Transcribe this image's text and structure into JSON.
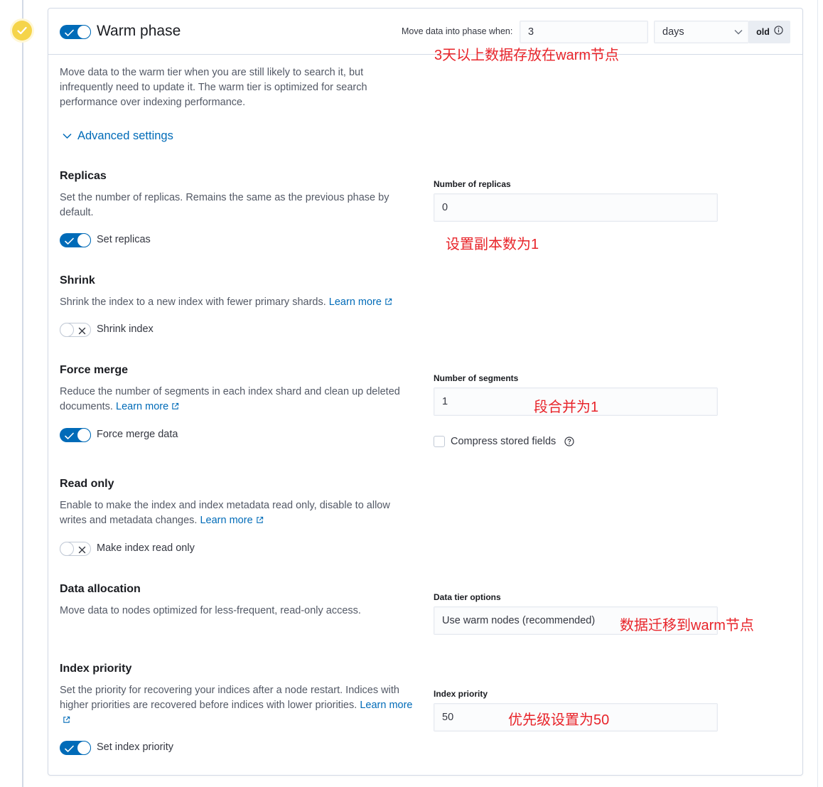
{
  "phase": {
    "title": "Warm phase",
    "enabled": true,
    "move_label": "Move data into phase when:",
    "min_age_value": "3",
    "min_age_unit": "days",
    "age_suffix": "old",
    "description": "Move data to the warm tier when you are still likely to search it, but infrequently need to update it. The warm tier is optimized for search performance over indexing performance.",
    "advanced_label": "Advanced settings"
  },
  "replicas": {
    "title": "Replicas",
    "description": "Set the number of replicas. Remains the same as the previous phase by default.",
    "toggle_label": "Set replicas",
    "toggle_on": true,
    "field_label": "Number of replicas",
    "field_value": "0"
  },
  "shrink": {
    "title": "Shrink",
    "description": "Shrink the index to a new index with fewer primary shards.",
    "learn_more": "Learn more",
    "toggle_label": "Shrink index",
    "toggle_on": false
  },
  "forcemerge": {
    "title": "Force merge",
    "description": "Reduce the number of segments in each index shard and clean up deleted documents.",
    "learn_more": "Learn more",
    "toggle_label": "Force merge data",
    "toggle_on": true,
    "field_label": "Number of segments",
    "field_value": "1",
    "compress_label": "Compress stored fields",
    "compress_checked": false
  },
  "readonly": {
    "title": "Read only",
    "description": "Enable to make the index and index metadata read only, disable to allow writes and metadata changes.",
    "learn_more": "Learn more",
    "toggle_label": "Make index read only",
    "toggle_on": false
  },
  "allocation": {
    "title": "Data allocation",
    "description": "Move data to nodes optimized for less-frequent, read-only access.",
    "field_label": "Data tier options",
    "field_value": "Use warm nodes (recommended)"
  },
  "priority": {
    "title": "Index priority",
    "description": "Set the priority for recovering your indices after a node restart. Indices with higher priorities are recovered before indices with lower priorities.",
    "learn_more_1": "Learn",
    "learn_more_2": "more",
    "toggle_label": "Set index priority",
    "toggle_on": true,
    "field_label": "Index priority",
    "field_value": "50"
  },
  "annotations": {
    "age_note": "3天以上数据存放在warm节点",
    "replicas_note": "设置副本数为1",
    "segments_note": "段合并为1",
    "allocation_note": "数据迁移到warm节点",
    "priority_note": "优先级设置为50"
  },
  "colors": {
    "accent": "#006bb8",
    "phase_dot": "#f5d44a",
    "annotation": "#e8242a"
  }
}
